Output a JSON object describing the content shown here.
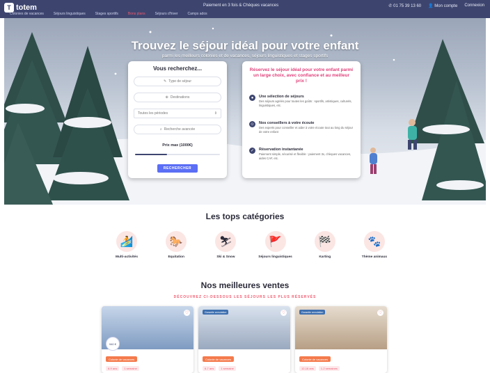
{
  "topbar": {
    "logo_text": "totem",
    "promo": "Paiement en 3 fois & Chèques vacances",
    "phone": "01 75 39 13 60",
    "account": "Mon compte",
    "login": "Connexion"
  },
  "nav": [
    "Colonies de vacances",
    "Séjours linguistiques",
    "Stages sportifs",
    "Bons plans",
    "Séjours d'hiver",
    "Camps ados"
  ],
  "hero": {
    "title": "Trouvez le séjour idéal pour votre enfant",
    "subtitle": "parmi les meilleurs colonies et de vacances, séjours linguistiques et stages sportifs"
  },
  "search": {
    "title": "Vous recherchez...",
    "type_placeholder": "Type de séjour",
    "destination_placeholder": "Destinations",
    "period_value": "Toutes les périodes",
    "advanced_label": "Recherche avancée",
    "price_label": "Prix max (1000€)",
    "price_fraction": 0.38,
    "button": "RECHERCHER"
  },
  "info": {
    "title": "Réservez le séjour idéal pour votre enfant parmi un large choix, avec confiance et au meilleur prix !",
    "features": [
      {
        "icon": "globe-icon",
        "glyph": "●",
        "title": "Une sélection de séjours",
        "text": "Des séjours agréés pour toutes les goûts : sportifs, artistiques, culturels, linguistiques, etc."
      },
      {
        "icon": "advisor-icon",
        "glyph": "☺",
        "title": "Nos conseillers à votre écoute",
        "text": "Des experts pour conseiller et aider à votre écoute tout au long du séjour de votre enfant"
      },
      {
        "icon": "tag-icon",
        "glyph": "✓",
        "title": "Réservation instantanée",
        "text": "Paiement simple, sécurisé et flexible : paiement 3x, chèques vacances, aides CAF, etc."
      }
    ]
  },
  "categories": {
    "title": "Les tops catégories",
    "items": [
      {
        "label": "Multi-activités",
        "icon": "multi-activity-icon",
        "glyph": "🏄"
      },
      {
        "label": "Equitation",
        "icon": "horse-icon",
        "glyph": "🐎"
      },
      {
        "label": "Ski & Snow",
        "icon": "ski-icon",
        "glyph": "⛷"
      },
      {
        "label": "Séjours linguistiques",
        "icon": "flag-icon",
        "glyph": "🚩"
      },
      {
        "label": "Karting",
        "icon": "kart-icon",
        "glyph": "🏁"
      },
      {
        "label": "Thème animaux",
        "icon": "paw-icon",
        "glyph": "🐾"
      }
    ]
  },
  "bestsellers": {
    "title": "Nos meilleures ventes",
    "subtitle": "DÉCOUVREZ CI-DESSOUS LES SÉJOURS LES PLUS RÉSERVÉS",
    "cards": [
      {
        "tag": "",
        "badge": "Colonie de vacances",
        "age": "6-9 ans",
        "duration": "1 semaine",
        "price": "940 €",
        "colors": [
          "#c7d6ea",
          "#7e9bc1"
        ]
      },
      {
        "tag": "Garantie annulation",
        "badge": "Colonie de vacances",
        "age": "6-7 ans",
        "duration": "1 semaine",
        "price": "",
        "colors": [
          "#d9e2ee",
          "#9aa9bf"
        ]
      },
      {
        "tag": "Garantie annulation",
        "badge": "Colonie de vacances",
        "age": "12-16 ans",
        "duration": "1-2 semaines",
        "price": "",
        "colors": [
          "#e6dccf",
          "#b79f85"
        ]
      }
    ]
  }
}
